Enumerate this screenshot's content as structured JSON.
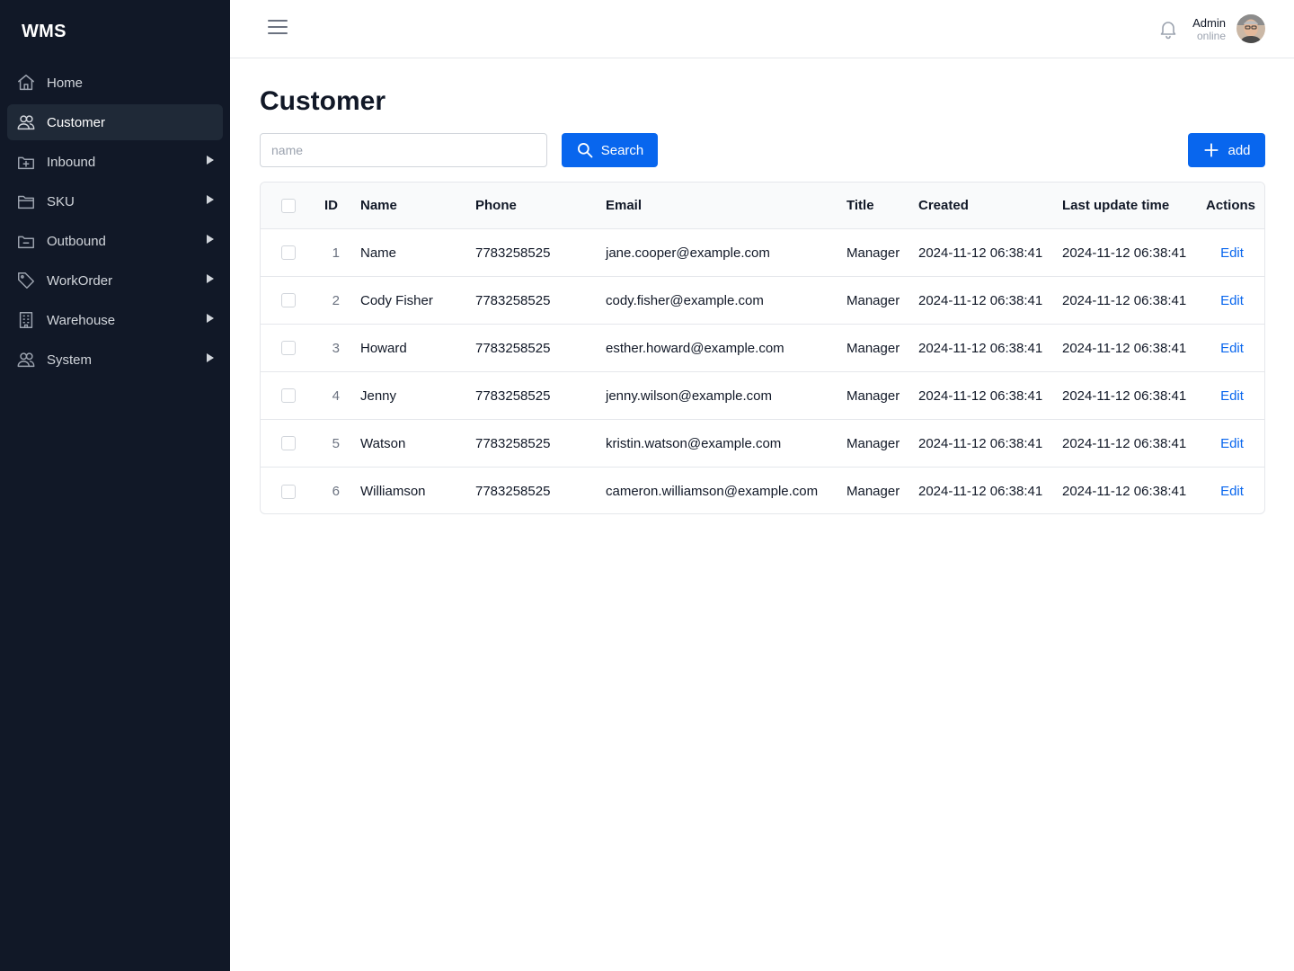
{
  "app": {
    "logo": "WMS"
  },
  "sidebar": {
    "items": [
      {
        "label": "Home",
        "icon": "home-icon",
        "active": false,
        "expandable": false
      },
      {
        "label": "Customer",
        "icon": "users-icon",
        "active": true,
        "expandable": false
      },
      {
        "label": "Inbound",
        "icon": "inbox-plus-icon",
        "active": false,
        "expandable": true
      },
      {
        "label": "SKU",
        "icon": "folder-icon",
        "active": false,
        "expandable": true
      },
      {
        "label": "Outbound",
        "icon": "inbox-minus-icon",
        "active": false,
        "expandable": true
      },
      {
        "label": "WorkOrder",
        "icon": "tag-icon",
        "active": false,
        "expandable": true
      },
      {
        "label": "Warehouse",
        "icon": "building-icon",
        "active": false,
        "expandable": true
      },
      {
        "label": "System",
        "icon": "users-icon",
        "active": false,
        "expandable": true
      }
    ]
  },
  "header": {
    "user": {
      "name": "Admin",
      "status": "online"
    }
  },
  "main": {
    "title": "Customer",
    "search": {
      "placeholder": "name",
      "value": "",
      "button_label": "Search"
    },
    "add_button_label": "add",
    "table": {
      "columns": [
        "ID",
        "Name",
        "Phone",
        "Email",
        "Title",
        "Created",
        "Last update time",
        "Actions"
      ],
      "rows": [
        {
          "id": "1",
          "name": "Name",
          "phone": "7783258525",
          "email": "jane.cooper@example.com",
          "title": "Manager",
          "created": "2024-11-12 06:38:41",
          "updated": "2024-11-12 06:38:41",
          "action": "Edit"
        },
        {
          "id": "2",
          "name": "Cody Fisher",
          "phone": "7783258525",
          "email": "cody.fisher@example.com",
          "title": "Manager",
          "created": "2024-11-12 06:38:41",
          "updated": "2024-11-12 06:38:41",
          "action": "Edit"
        },
        {
          "id": "3",
          "name": "Howard",
          "phone": "7783258525",
          "email": "esther.howard@example.com",
          "title": "Manager",
          "created": "2024-11-12 06:38:41",
          "updated": "2024-11-12 06:38:41",
          "action": "Edit"
        },
        {
          "id": "4",
          "name": "Jenny",
          "phone": "7783258525",
          "email": "jenny.wilson@example.com",
          "title": "Manager",
          "created": "2024-11-12 06:38:41",
          "updated": "2024-11-12 06:38:41",
          "action": "Edit"
        },
        {
          "id": "5",
          "name": "Watson",
          "phone": "7783258525",
          "email": "kristin.watson@example.com",
          "title": "Manager",
          "created": "2024-11-12 06:38:41",
          "updated": "2024-11-12 06:38:41",
          "action": "Edit"
        },
        {
          "id": "6",
          "name": "Williamson",
          "phone": "7783258525",
          "email": "cameron.williamson@example.com",
          "title": "Manager",
          "created": "2024-11-12 06:38:41",
          "updated": "2024-11-12 06:38:41",
          "action": "Edit"
        }
      ]
    }
  },
  "colors": {
    "sidebar_bg": "#111827",
    "sidebar_active_bg": "#1f2937",
    "primary": "#0866ee",
    "border": "#e5e7eb",
    "table_header_bg": "#f9fafb"
  }
}
